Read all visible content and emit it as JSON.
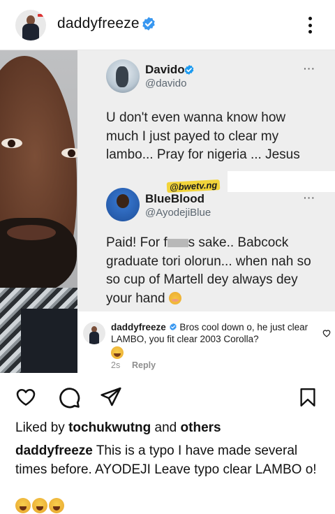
{
  "header": {
    "username": "daddyfreeze",
    "verified_icon": "verified-badge-icon",
    "more_icon": "more-vertical-icon"
  },
  "post": {
    "tweets": [
      {
        "name": "Davido",
        "handle": "@davido",
        "dots": "···",
        "text": "U don't even wanna know how much I just payed to clear my lambo... Pray for nigeria ... Jesus"
      },
      {
        "name": "BlueBlood",
        "handle": "@AyodejiBlue",
        "dots": "···",
        "text_before": "Paid! For f",
        "text_after": "s sake.. Babcock graduate  tori olorun... when nah so so cup of Martell dey always dey your hand"
      }
    ],
    "watermark": "@bwetv.ng",
    "comment": {
      "username": "daddyfreeze",
      "text": "Bros cool down o, he just clear LAMBO, you fit clear 2003 Corolla?",
      "time": "2s",
      "reply_label": "Reply"
    }
  },
  "actions": {
    "like_icon": "heart-icon",
    "comment_icon": "comment-icon",
    "share_icon": "share-icon",
    "save_icon": "bookmark-icon"
  },
  "likes": {
    "prefix": "Liked by",
    "user": "tochukwutng",
    "joiner": "and",
    "others": "others"
  },
  "caption": {
    "username": "daddyfreeze",
    "text": "This is a typo I have made several times before. AYODEJI Leave typo clear LAMBO o!"
  },
  "colors": {
    "verified_blue": "#3897f0",
    "muted_text": "#8e8e8e",
    "twitter_handle": "#5b6670"
  }
}
